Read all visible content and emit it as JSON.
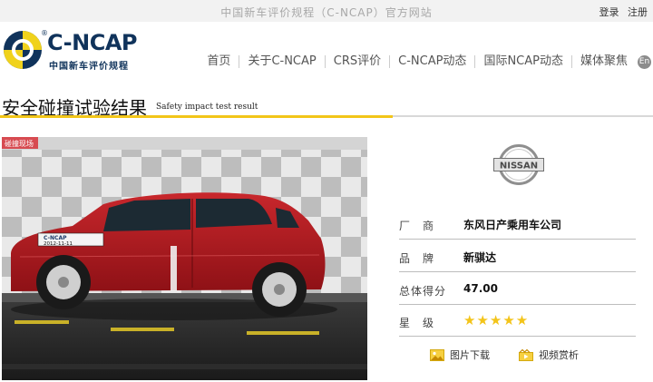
{
  "site": {
    "title": "中国新车评价规程（C-NCAP）官方网站",
    "login": "登录",
    "register": "注册"
  },
  "logo": {
    "text": "C-NCAP",
    "registered": "®",
    "subtitle": "中国新车评价规程"
  },
  "nav": {
    "items": [
      "首页",
      "关于C-NCAP",
      "CRS评价",
      "C-NCAP动态",
      "国际NCAP动态",
      "媒体聚焦"
    ],
    "lang": "En"
  },
  "page": {
    "heading": "安全碰撞试验结果",
    "heading_en": "Safety impact test result"
  },
  "photo": {
    "corner_tag": "碰撞现场",
    "placard": "C-NCAP\n2012-11-11"
  },
  "brand": {
    "logo_text": "NISSAN"
  },
  "info": {
    "manufacturer_label": "厂　商",
    "manufacturer_value": "东风日产乘用车公司",
    "brand_label": "品　牌",
    "brand_value": "新骐达",
    "score_label": "总体得分",
    "score_value": "47.00",
    "stars_label": "星　级",
    "stars_value": "★★★★★",
    "stars_count": 5
  },
  "actions": {
    "photos": "图片下载",
    "video": "视频赏析"
  },
  "colors": {
    "accent": "#f2c619",
    "brand_navy": "#10335b",
    "car_red": "#b2171d"
  }
}
